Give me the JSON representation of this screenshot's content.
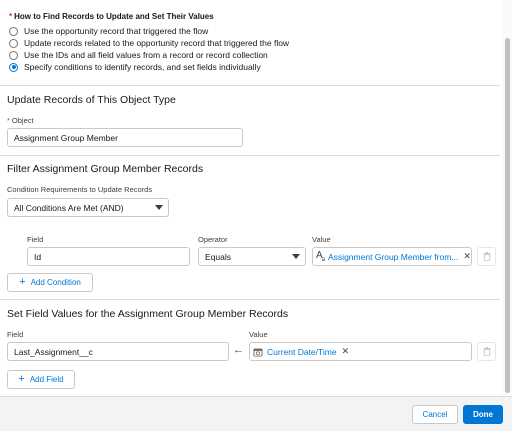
{
  "find_records": {
    "title": "How to Find Records to Update and Set Their Values",
    "options": [
      "Use the opportunity record that triggered the flow",
      "Update records related to the opportunity record that triggered the flow",
      "Use the IDs and all field values from a record or record collection",
      "Specify conditions to identify records, and set fields individually"
    ],
    "selected_index": 3
  },
  "object_section": {
    "title": "Update Records of This Object Type",
    "object_label": "Object",
    "object_value": "Assignment Group Member"
  },
  "filter_section": {
    "title": "Filter Assignment Group Member Records",
    "condition_req_label": "Condition Requirements to Update Records",
    "condition_req_value": "All Conditions Are Met (AND)",
    "field_label": "Field",
    "operator_label": "Operator",
    "value_label": "Value",
    "condition": {
      "field": "Id",
      "operator": "Equals",
      "value": "Assignment Group Member from..."
    },
    "add_condition_label": "Add Condition"
  },
  "set_fields_section": {
    "title": "Set Field Values for the Assignment Group Member Records",
    "field_label": "Field",
    "value_label": "Value",
    "row": {
      "field": "Last_Assignment__c",
      "value": "Current Date/Time"
    },
    "add_field_label": "Add Field"
  },
  "footer": {
    "cancel_label": "Cancel",
    "done_label": "Done"
  },
  "colors": {
    "brand": "#0176d3",
    "required": "#c23934",
    "border": "#c9c9c9"
  }
}
